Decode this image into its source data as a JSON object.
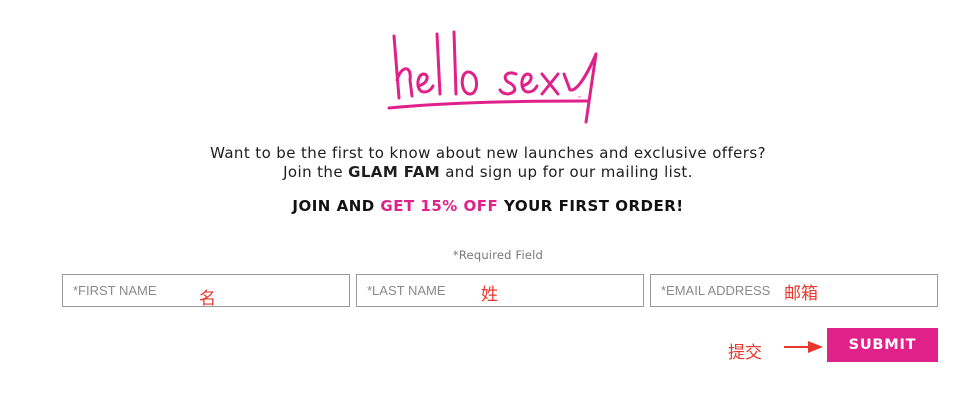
{
  "brand": {
    "logo_text": "hello sexy",
    "accent_color": "#e0218a"
  },
  "intro": {
    "line1": "Want to be the first to know about new launches and exclusive offers?",
    "line2_pre": "Join the ",
    "line2_bold": "GLAM FAM",
    "line2_post": " and sign up for our mailing list."
  },
  "promo": {
    "pre": "JOIN AND ",
    "highlight": "GET 15% OFF",
    "post": " YOUR FIRST ORDER!"
  },
  "form": {
    "required_note": "*Required Field",
    "first_name": {
      "placeholder": "*FIRST NAME",
      "annotation": "名"
    },
    "last_name": {
      "placeholder": "*LAST NAME",
      "annotation": "姓"
    },
    "email": {
      "placeholder": "*EMAIL ADDRESS",
      "annotation": "邮箱"
    },
    "submit_label": "SUBMIT",
    "submit_annotation": "提交"
  },
  "annotation_color": "#e8372d",
  "icons": {
    "annotation_arrow": "arrow-right-icon"
  }
}
